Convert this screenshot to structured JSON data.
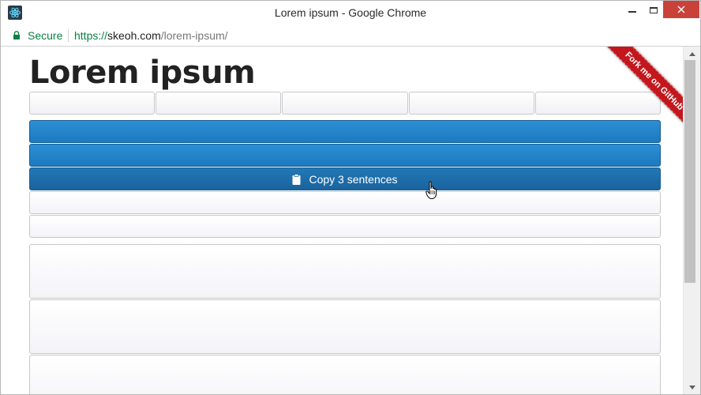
{
  "window": {
    "title": "Lorem ipsum - Google Chrome"
  },
  "addressbar": {
    "secure_label": "Secure",
    "url_scheme": "https://",
    "url_host": "skeoh.com",
    "url_path": "/lorem-ipsum/"
  },
  "page": {
    "title": "Lorem ipsum",
    "segments": [
      "",
      "",
      "",
      "",
      ""
    ],
    "copy_button_label": "Copy 3 sentences",
    "ribbon_label": "Fork me on GitHub"
  },
  "colors": {
    "accent_blue": "#1f80c6",
    "ribbon_red": "#c4171d",
    "secure_green": "#0b8043",
    "close_red": "#c8423a"
  },
  "icons": {
    "app": "react-atom-icon",
    "lock": "lock-icon",
    "clipboard": "clipboard-icon",
    "cursor": "hand-pointer-icon"
  }
}
